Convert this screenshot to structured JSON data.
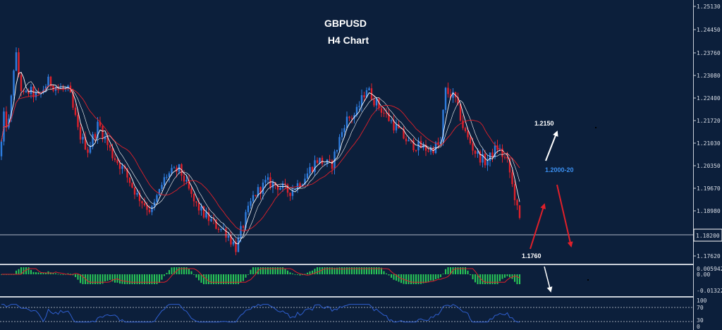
{
  "chart": {
    "title": "GBPUSD",
    "subtitle": "H4 Chart"
  },
  "colors": {
    "background": "#0c1f3b",
    "bull": "#2e7de0",
    "bear": "#e0202a",
    "fast_ma": "#ffffff",
    "slow_ma": "#e0202a",
    "histogram": "#29c957",
    "osc_line": "#2f5fd0",
    "level_label": "#3b8ff0",
    "arrow_up": "#ffffff",
    "arrow_down": "#e0202a"
  },
  "annotations": {
    "target_high": "1.2150",
    "range_label": "1.2000-20",
    "target_low": "1.1760"
  },
  "chart_data": {
    "type": "candlestick",
    "title": "GBPUSD",
    "subtitle": "H4 Chart",
    "price_axis_ticks": [
      "1.25130",
      "1.24450",
      "1.23760",
      "1.23080",
      "1.22400",
      "1.21720",
      "1.21030",
      "1.20350",
      "1.19670",
      "1.18980",
      "1.18200",
      "1.17620"
    ],
    "price_range": [
      1.1735,
      1.2535
    ],
    "current_price": "1.18200",
    "price_anchors": [
      [
        0,
        1.206
      ],
      [
        6,
        1.218
      ],
      [
        12,
        1.214
      ],
      [
        22,
        1.238
      ],
      [
        32,
        1.224
      ],
      [
        42,
        1.226
      ],
      [
        55,
        1.224
      ],
      [
        68,
        1.229
      ],
      [
        82,
        1.227
      ],
      [
        98,
        1.226
      ],
      [
        112,
        1.213
      ],
      [
        125,
        1.208
      ],
      [
        140,
        1.216
      ],
      [
        158,
        1.207
      ],
      [
        175,
        1.202
      ],
      [
        195,
        1.194
      ],
      [
        215,
        1.189
      ],
      [
        235,
        1.2
      ],
      [
        255,
        1.202
      ],
      [
        275,
        1.192
      ],
      [
        290,
        1.188
      ],
      [
        305,
        1.185
      ],
      [
        320,
        1.183
      ],
      [
        335,
        1.178
      ],
      [
        345,
        1.185
      ],
      [
        360,
        1.194
      ],
      [
        378,
        1.198
      ],
      [
        395,
        1.197
      ],
      [
        410,
        1.195
      ],
      [
        430,
        1.199
      ],
      [
        450,
        1.205
      ],
      [
        470,
        1.203
      ],
      [
        490,
        1.217
      ],
      [
        505,
        1.219
      ],
      [
        520,
        1.227
      ],
      [
        535,
        1.222
      ],
      [
        550,
        1.218
      ],
      [
        565,
        1.214
      ],
      [
        580,
        1.21
      ],
      [
        595,
        1.209
      ],
      [
        610,
        1.208
      ],
      [
        625,
        1.21
      ],
      [
        632,
        1.226
      ],
      [
        645,
        1.224
      ],
      [
        660,
        1.213
      ],
      [
        675,
        1.207
      ],
      [
        690,
        1.204
      ],
      [
        705,
        1.209
      ],
      [
        720,
        1.204
      ],
      [
        728,
        1.196
      ],
      [
        740,
        1.183
      ]
    ],
    "macd_panel": {
      "ticks": [
        "0.005942",
        "0.00",
        "-0.01322"
      ],
      "range": [
        -0.0168,
        0.0078
      ]
    },
    "rsi_panel": {
      "ticks": [
        "100",
        "70",
        "30",
        "0"
      ],
      "levels": [
        70,
        30
      ],
      "range": [
        0,
        100
      ]
    }
  }
}
